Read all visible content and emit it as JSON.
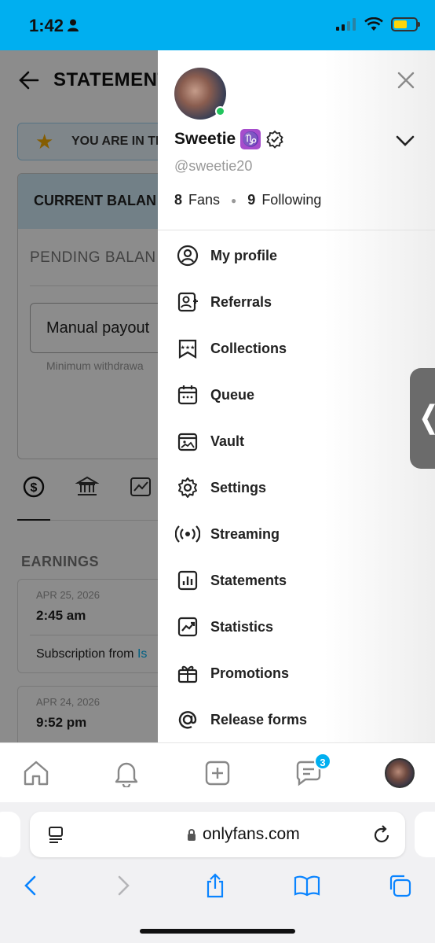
{
  "status_bar": {
    "time": "1:42"
  },
  "background_page": {
    "title": "STATEMENT",
    "banner_text": "YOU ARE IN TH",
    "current_balance_label": "CURRENT BALAN",
    "pending_balance_label": "PENDING BALAN",
    "payout_button_label": "Manual payout",
    "min_withdraw_text": "Minimum withdrawa",
    "earnings_label": "EARNINGS",
    "rows": [
      {
        "date": "APR 25, 2026",
        "time": "2:45 am",
        "subscription_text": "Subscription from ",
        "subscription_link": "Is"
      },
      {
        "date": "APR 24, 2026",
        "time": "9:52 pm"
      }
    ]
  },
  "drawer": {
    "name": "Sweetie",
    "zodiac_symbol": "♑",
    "handle": "@sweetie20",
    "fans_count": "8",
    "fans_label": "Fans",
    "following_count": "9",
    "following_label": "Following",
    "menu": [
      {
        "label": "My profile",
        "icon": "profile-icon"
      },
      {
        "label": "Referrals",
        "icon": "referrals-icon"
      },
      {
        "label": "Collections",
        "icon": "collections-icon"
      },
      {
        "label": "Queue",
        "icon": "calendar-icon"
      },
      {
        "label": "Vault",
        "icon": "vault-icon"
      },
      {
        "label": "Settings",
        "icon": "gear-icon"
      },
      {
        "label": "Streaming",
        "icon": "streaming-icon"
      },
      {
        "label": "Statements",
        "icon": "statements-icon"
      },
      {
        "label": "Statistics",
        "icon": "statistics-icon"
      },
      {
        "label": "Promotions",
        "icon": "gift-icon"
      },
      {
        "label": "Release forms",
        "icon": "at-icon"
      }
    ]
  },
  "bottom_nav": {
    "messages_badge": "3"
  },
  "safari": {
    "url": "onlyfans.com"
  },
  "colors": {
    "brand": "#00aff0",
    "online": "#22c55e",
    "zodiac": "#a64dcc"
  }
}
